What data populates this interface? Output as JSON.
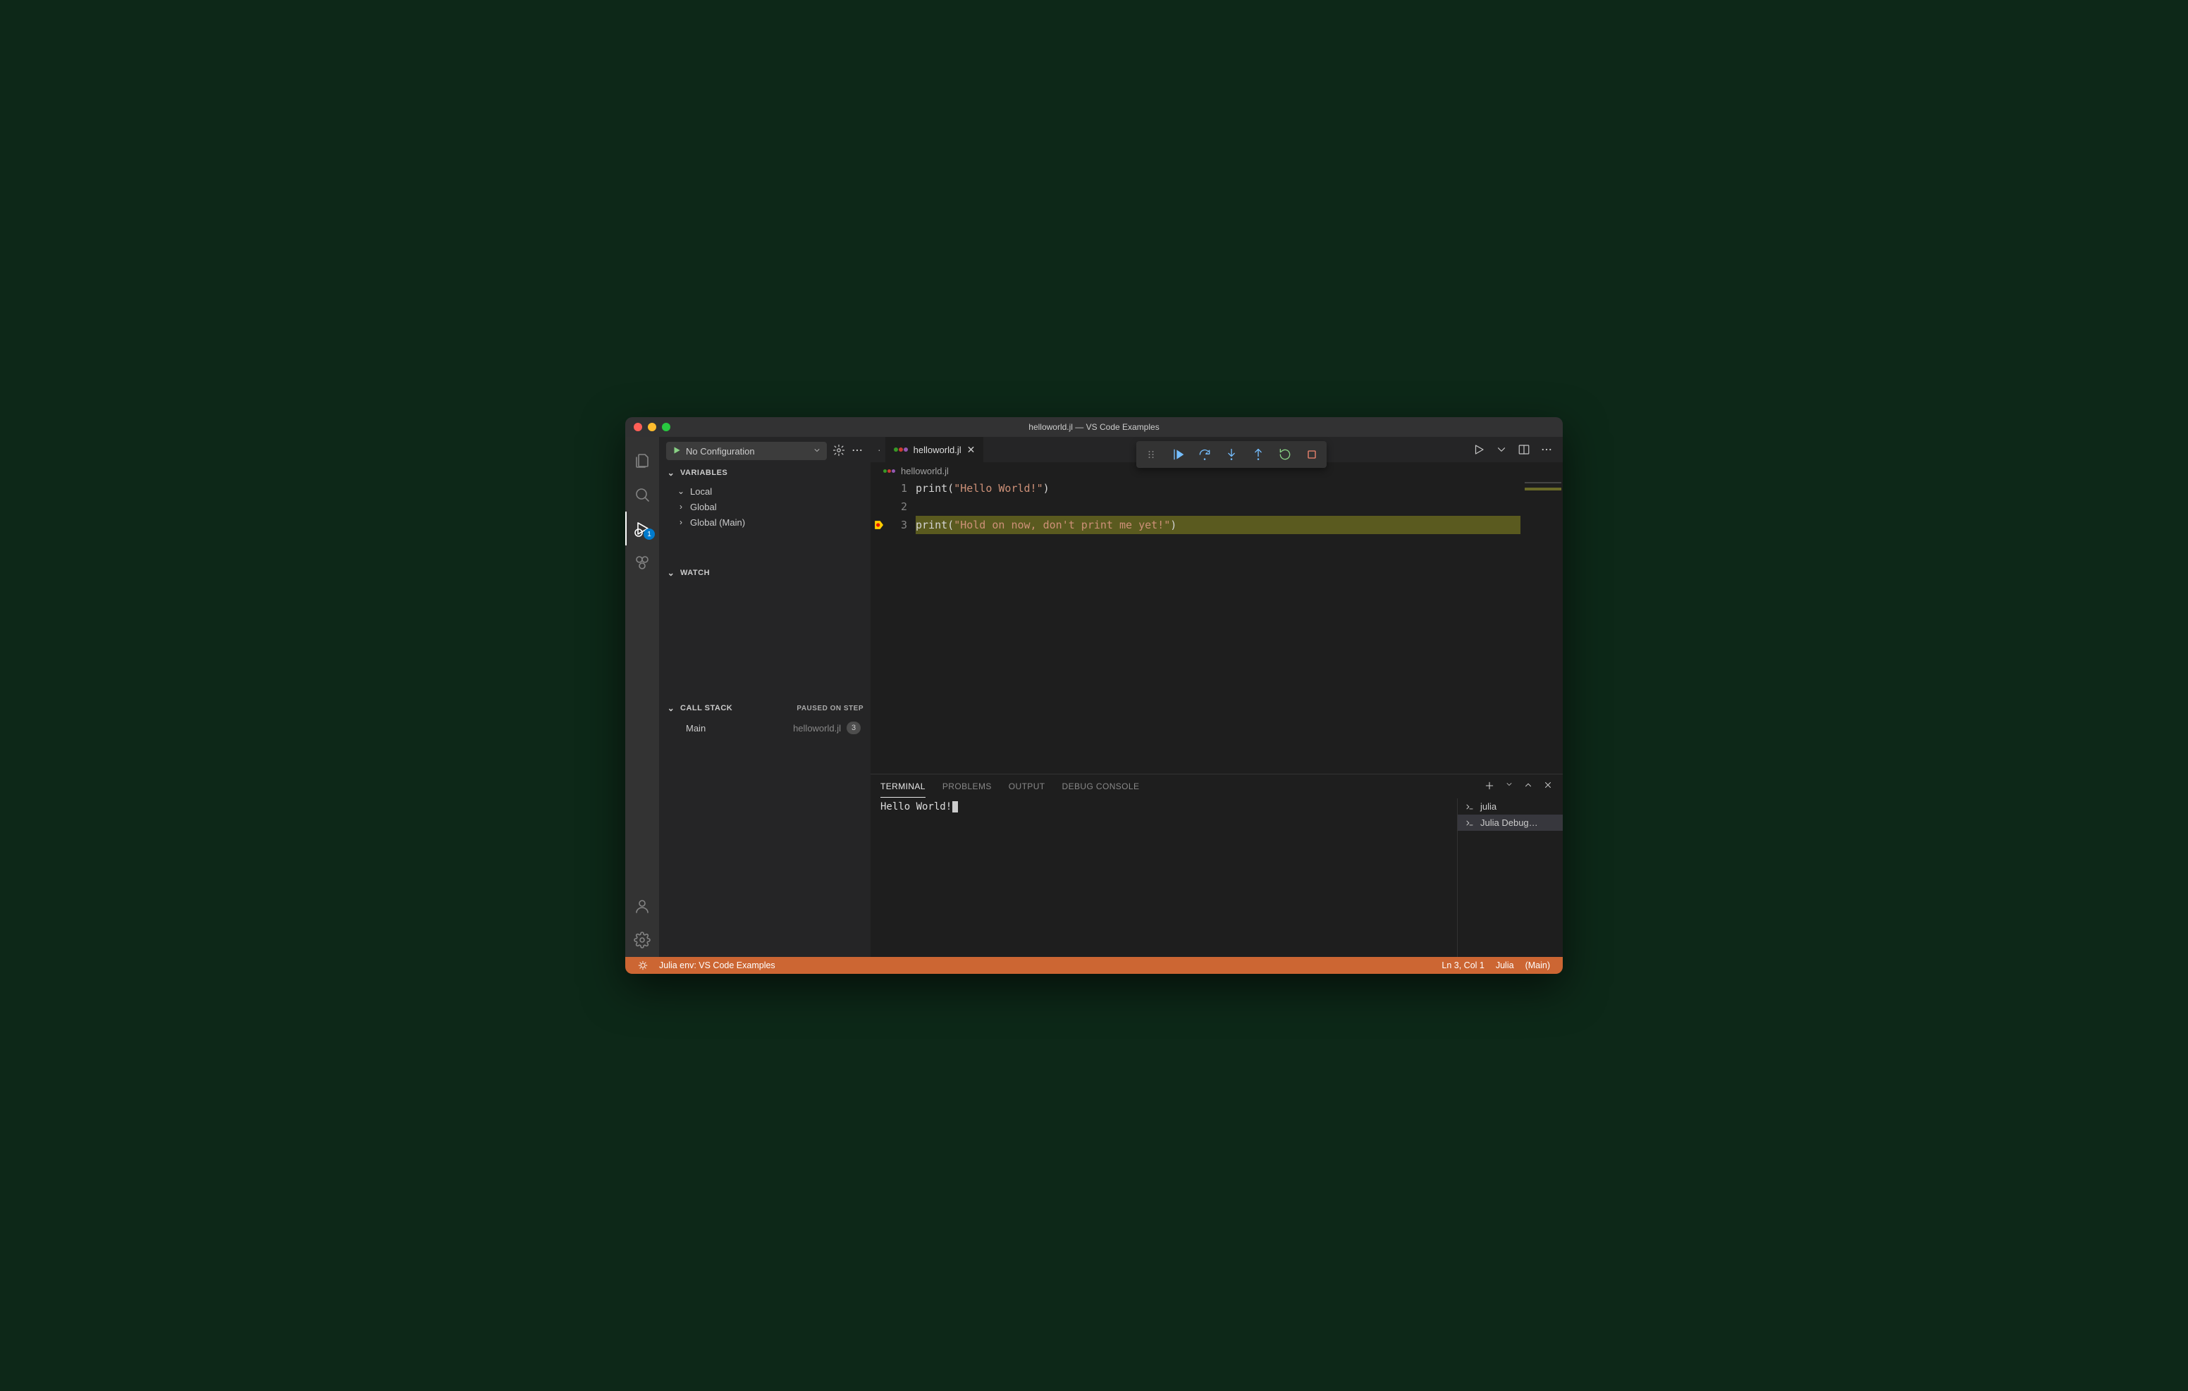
{
  "titlebar": {
    "title": "helloworld.jl — VS Code Examples"
  },
  "activitybar": {
    "debug_badge": "1"
  },
  "debug_sidebar": {
    "config_label": "No Configuration",
    "sections": {
      "variables": {
        "title": "VARIABLES",
        "items": [
          "Local",
          "Global",
          "Global (Main)"
        ]
      },
      "watch": {
        "title": "WATCH"
      },
      "callstack": {
        "title": "CALL STACK",
        "status": "PAUSED ON STEP",
        "frames": [
          {
            "name": "Main",
            "file": "helloworld.jl",
            "line": "3"
          }
        ]
      }
    }
  },
  "editor": {
    "tab_dirty_indicator": "·",
    "tab_filename": "helloworld.jl",
    "breadcrumb": "helloworld.jl",
    "lines": [
      {
        "num": "1",
        "fn": "print",
        "paren_open": "(",
        "str": "\"Hello World!\"",
        "paren_close": ")",
        "hl": false,
        "bp": false
      },
      {
        "num": "2",
        "fn": "",
        "paren_open": "",
        "str": "",
        "paren_close": "",
        "hl": false,
        "bp": false
      },
      {
        "num": "3",
        "fn": "print",
        "paren_open": "(",
        "str": "\"Hold on now, don't print me yet!\"",
        "paren_close": ")",
        "hl": true,
        "bp": true
      }
    ]
  },
  "panel": {
    "tabs": [
      "TERMINAL",
      "PROBLEMS",
      "OUTPUT",
      "DEBUG CONSOLE"
    ],
    "active_tab_index": 0,
    "terminal_output": "Hello World!",
    "terminals": [
      {
        "label": "julia",
        "active": false
      },
      {
        "label": "Julia Debug…",
        "active": true
      }
    ]
  },
  "statusbar": {
    "env": "Julia env: VS Code Examples",
    "cursor": "Ln 3, Col 1",
    "lang": "Julia",
    "scope": "(Main)"
  }
}
